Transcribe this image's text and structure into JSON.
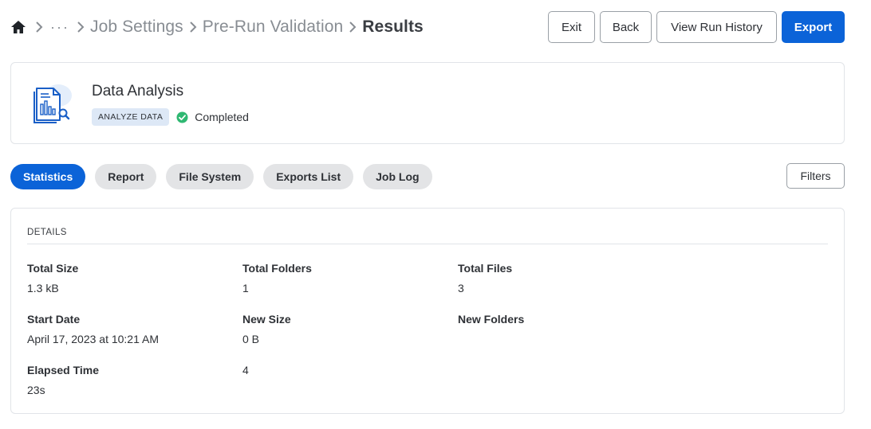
{
  "breadcrumb": {
    "ellipsis": "···",
    "items": [
      "Job Settings",
      "Pre-Run Validation"
    ],
    "current": "Results"
  },
  "actions": {
    "exit": "Exit",
    "back": "Back",
    "view_run_history": "View Run History",
    "export": "Export"
  },
  "job": {
    "title": "Data Analysis",
    "badge": "ANALYZE DATA",
    "status": "Completed",
    "status_color": "#2fb872"
  },
  "tabs": [
    "Statistics",
    "Report",
    "File System",
    "Exports List",
    "Job Log"
  ],
  "filters_label": "Filters",
  "details": {
    "heading": "DETAILS",
    "total_size": {
      "label": "Total Size",
      "value": "1.3 kB"
    },
    "total_folders": {
      "label": "Total Folders",
      "value": "1"
    },
    "total_files": {
      "label": "Total Files",
      "value": "3"
    },
    "start_date": {
      "label": "Start Date",
      "value": "April 17, 2023 at 10:21 AM"
    },
    "new_size": {
      "label": "New Size",
      "value": "0 B"
    },
    "new_folders": {
      "label": "New Folders",
      "value": ""
    },
    "elapsed_time": {
      "label": "Elapsed Time",
      "value": "23s"
    },
    "unlabeled_value": "4"
  },
  "colors": {
    "primary": "#0b63d8",
    "badge_bg": "#dde8f6"
  }
}
